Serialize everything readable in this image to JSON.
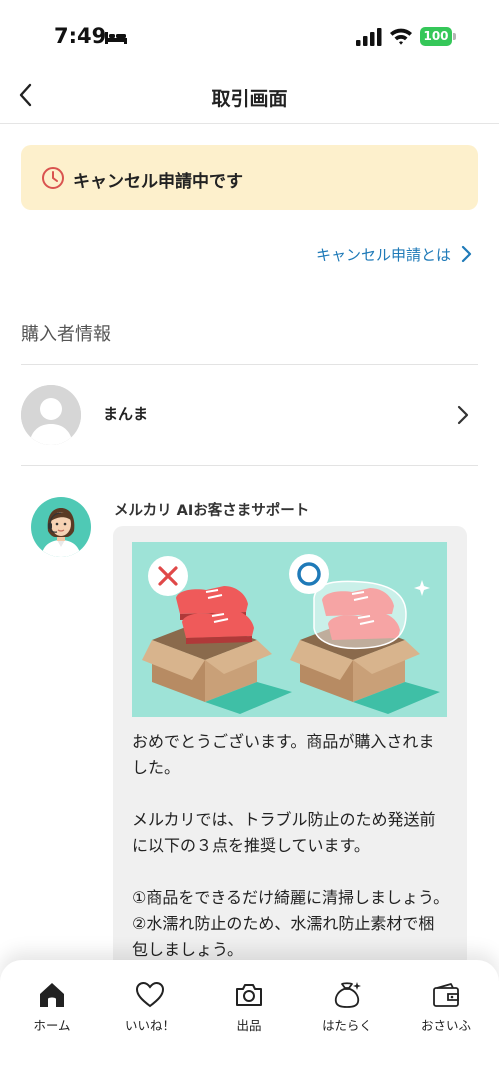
{
  "status_bar": {
    "time": "7:49",
    "battery": "100"
  },
  "header": {
    "title": "取引画面"
  },
  "banner": {
    "text": "キャンセル申請中です"
  },
  "cancel_link": {
    "label": "キャンセル申請とは"
  },
  "buyer_section": {
    "title": "購入者情報",
    "buyer_name": "まんま"
  },
  "support_message": {
    "sender": "メルカリ AIお客さまサポート",
    "body": "おめでとうございます。商品が購入されました。\n\nメルカリでは、トラブル防止のため発送前に以下の３点を推奨しています。\n\n①商品をできるだけ綺麗に清掃しましょう。\n②水濡れ防止のため、水濡れ防止素材で梱包しましょう。"
  },
  "bottom_nav": {
    "items": [
      {
        "label": "ホーム",
        "icon": "home-icon",
        "active": true
      },
      {
        "label": "いいね！",
        "icon": "heart-icon"
      },
      {
        "label": "出品",
        "icon": "camera-icon"
      },
      {
        "label": "はたらく",
        "icon": "money-bag-icon"
      },
      {
        "label": "おさいふ",
        "icon": "wallet-icon"
      }
    ]
  },
  "colors": {
    "banner_bg": "#fdf0cc",
    "link": "#1f7ab8",
    "alert_red": "#d9534f",
    "battery_green": "#35c759"
  }
}
